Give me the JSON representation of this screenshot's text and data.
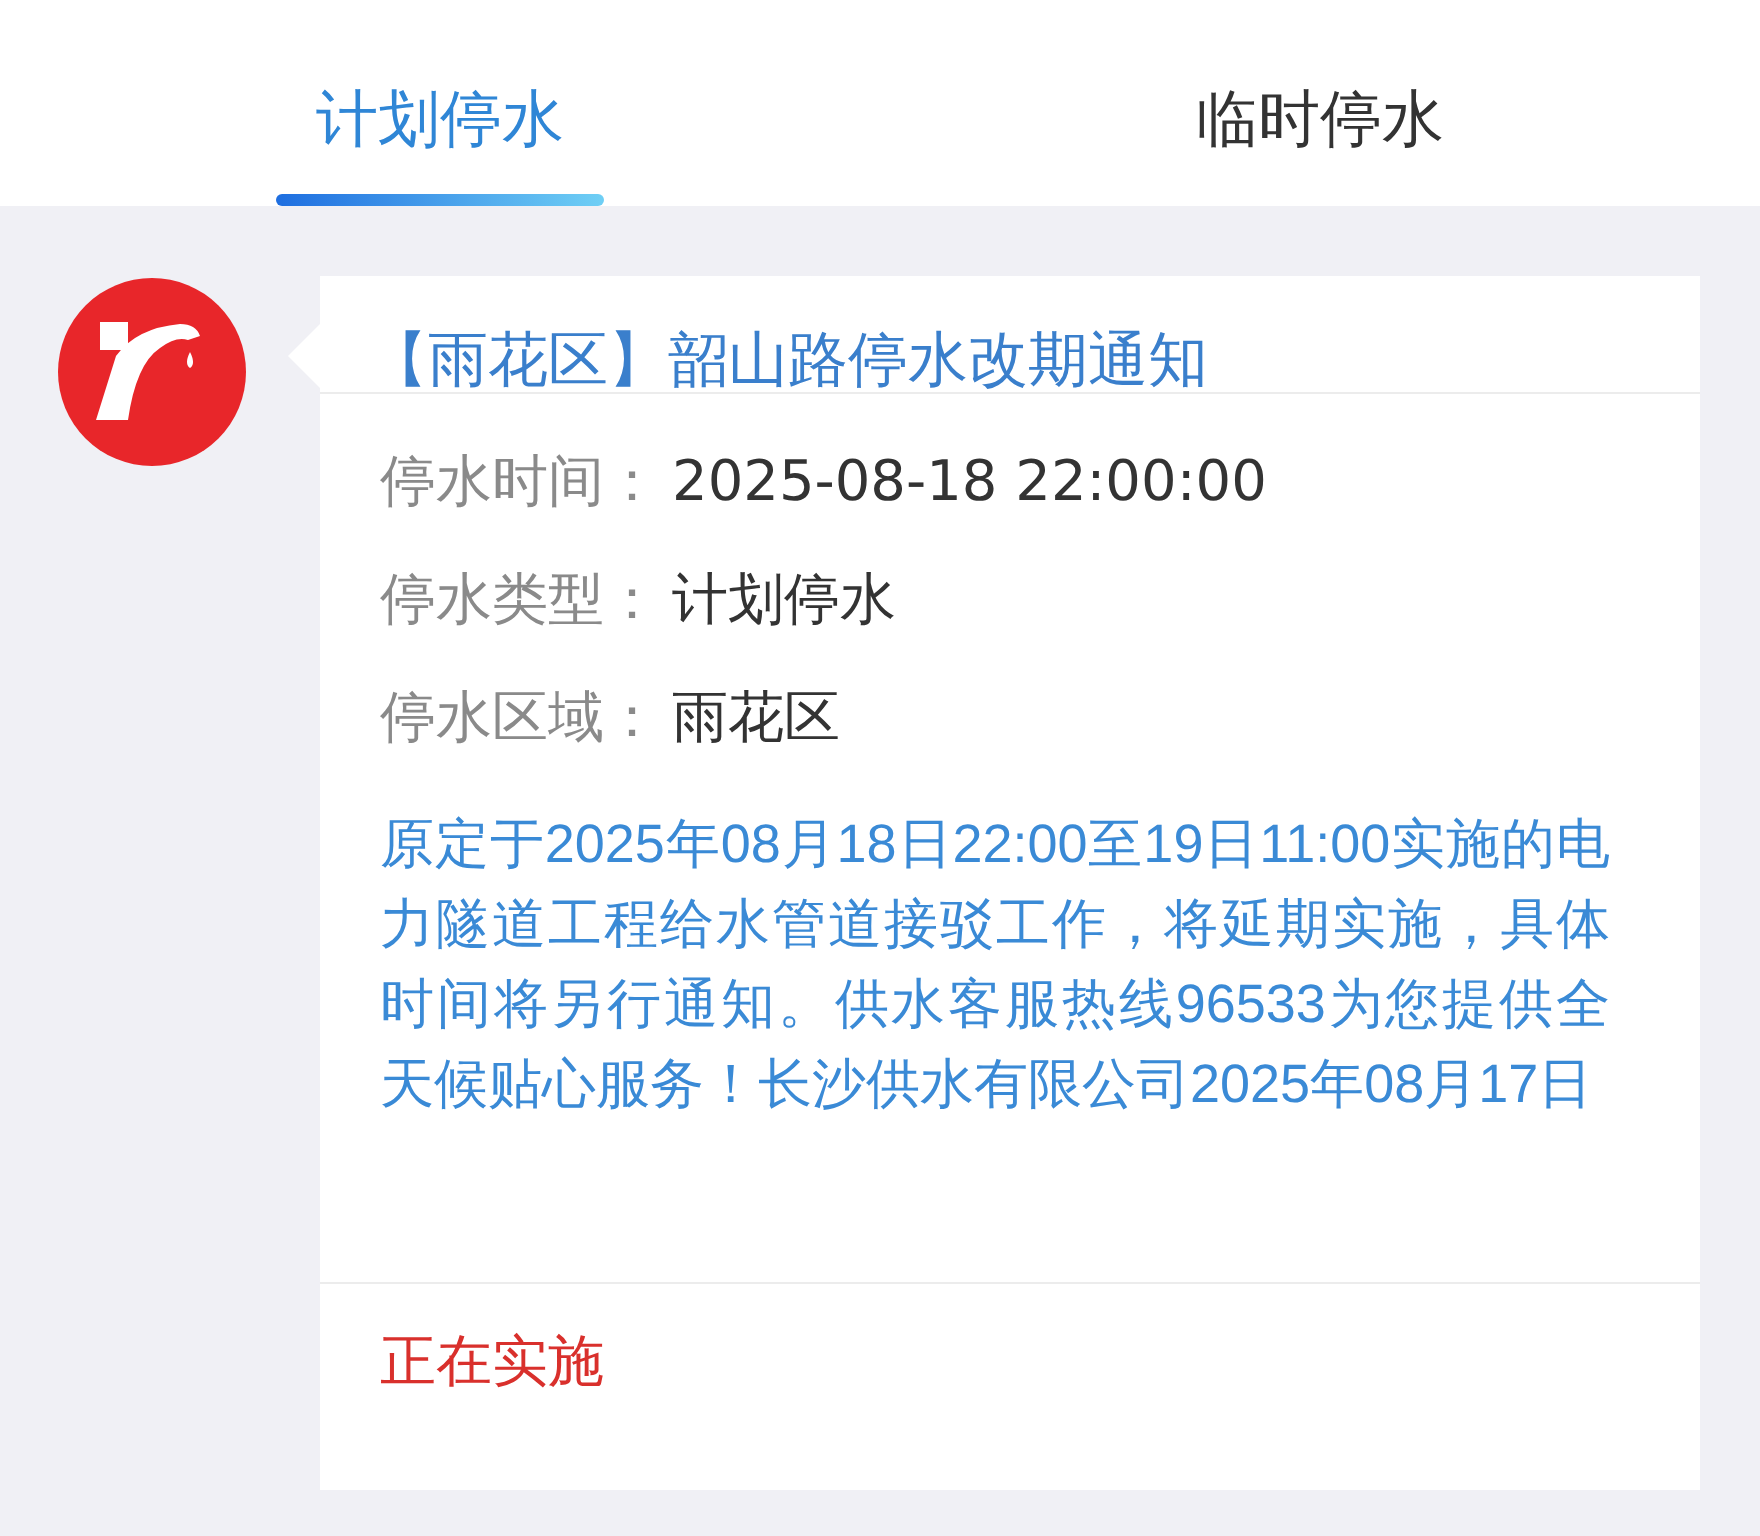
{
  "tabs": [
    {
      "label": "计划停水",
      "selected": true
    },
    {
      "label": "临时停水",
      "selected": false
    }
  ],
  "notice": {
    "title": "【雨花区】韶山路停水改期通知",
    "fields": [
      {
        "label": "停水时间：",
        "value": "2025-08-18 22:00:00"
      },
      {
        "label": "停水类型：",
        "value": "计划停水"
      },
      {
        "label": "停水区域：",
        "value": "雨花区"
      }
    ],
    "description": "原定于2025年08月18日22:00至19日11:00实施的电力隧道工程给水管道接驳工作，将延期实施，具体时间将另行通知。供水客服热线96533为您提供全天候贴心服务！长沙供水有限公司2025年08月17日",
    "status": "正在实施"
  }
}
